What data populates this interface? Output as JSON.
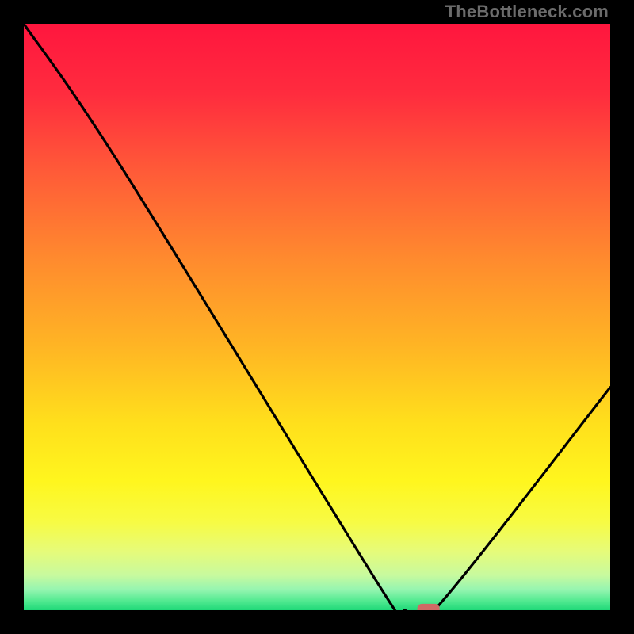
{
  "watermark": "TheBottleneck.com",
  "chart_data": {
    "type": "line",
    "title": "",
    "xlabel": "",
    "ylabel": "",
    "xlim": [
      0,
      100
    ],
    "ylim": [
      0,
      100
    ],
    "grid": false,
    "legend": false,
    "curve": [
      {
        "x": 0,
        "y": 100
      },
      {
        "x": 17,
        "y": 75
      },
      {
        "x": 62,
        "y": 2
      },
      {
        "x": 65,
        "y": 0
      },
      {
        "x": 70,
        "y": 0
      },
      {
        "x": 100,
        "y": 38
      }
    ],
    "marker": {
      "x": 69,
      "y": 0,
      "w": 3.8,
      "h": 2.2,
      "color": "#cf6a65"
    },
    "gradient_stops": [
      {
        "offset": 0.0,
        "color": "#ff163e"
      },
      {
        "offset": 0.12,
        "color": "#ff2c3e"
      },
      {
        "offset": 0.25,
        "color": "#ff5a38"
      },
      {
        "offset": 0.4,
        "color": "#ff8a2e"
      },
      {
        "offset": 0.55,
        "color": "#ffb524"
      },
      {
        "offset": 0.68,
        "color": "#ffdf1c"
      },
      {
        "offset": 0.78,
        "color": "#fff61e"
      },
      {
        "offset": 0.85,
        "color": "#f7fb44"
      },
      {
        "offset": 0.9,
        "color": "#e6fb7a"
      },
      {
        "offset": 0.94,
        "color": "#c8fa9e"
      },
      {
        "offset": 0.965,
        "color": "#95f5b0"
      },
      {
        "offset": 0.985,
        "color": "#4fe98f"
      },
      {
        "offset": 1.0,
        "color": "#1fd878"
      }
    ]
  }
}
